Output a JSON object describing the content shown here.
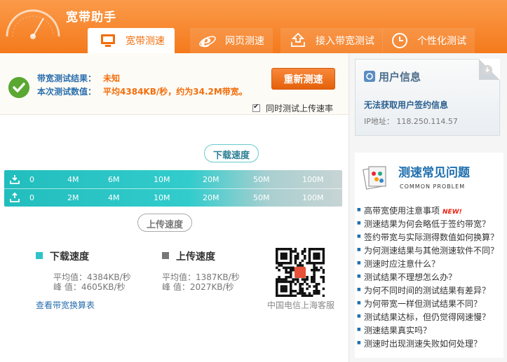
{
  "app": {
    "title": "宽带助手"
  },
  "tabs": [
    {
      "label": "宽带测速",
      "icon": "monitor-icon",
      "active": true
    },
    {
      "label": "网页测速",
      "icon": "ie-browser-icon",
      "active": false
    },
    {
      "label": "接入带宽测试",
      "icon": "upload-tray-icon",
      "active": false
    },
    {
      "label": "个性化测试",
      "icon": "clock-icon",
      "active": false
    }
  ],
  "result": {
    "bandwidth_label": "带宽测试结果：",
    "bandwidth_value": "未知",
    "speed_label": "本次测试数值：",
    "speed_value": "平均4384KB/秒，约为34.2M带宽。",
    "retest_button": "重新测速",
    "upload_checkbox_label": "同时测试上传速率",
    "upload_checkbox_checked": true
  },
  "speedbar": {
    "download_bubble": "下载速度",
    "upload_bubble": "上传速度",
    "download_ticks": [
      "0",
      "4M",
      "6M",
      "10M",
      "20M",
      "50M",
      "100M"
    ],
    "upload_ticks": [
      "0",
      "2M",
      "4M",
      "10M",
      "20M",
      "50M",
      "100M"
    ]
  },
  "legend": {
    "download": {
      "title": "下载速度",
      "avg": "平均值：4384KB/秒",
      "peak": "峰  值：4605KB/秒",
      "color": "#2fc2c8"
    },
    "upload": {
      "title": "上传速度",
      "avg": "平均值：1387KB/秒",
      "peak": "峰  值：2027KB/秒",
      "color": "#777777"
    },
    "conversion_link": "查看带宽换算表",
    "qr_caption": "中国电信上海客服"
  },
  "user": {
    "title": "用户信息",
    "error": "无法获取用户签约信息",
    "ip": "IP地址： 118.250.114.57"
  },
  "faq": {
    "title": "测速常见问题",
    "subtitle": "COMMON PROBLEM",
    "new_tag": "NEW!",
    "items": [
      "高带宽使用注意事项",
      "测速结果为何会略低于签约带宽？",
      "签约带宽与实际测得数值如何换算？",
      "为何测速结果与其他测速软件不同？",
      "测速时应注意什么？",
      "测试结果不理想怎么办？",
      "为何不同时间的测试结果有差异？",
      "为何带宽一样但测试结果不同？",
      "测试结果达标，但仍觉得网速慢？",
      "测速结果真实吗？",
      "测速时出现测速失败如何处理？"
    ]
  }
}
